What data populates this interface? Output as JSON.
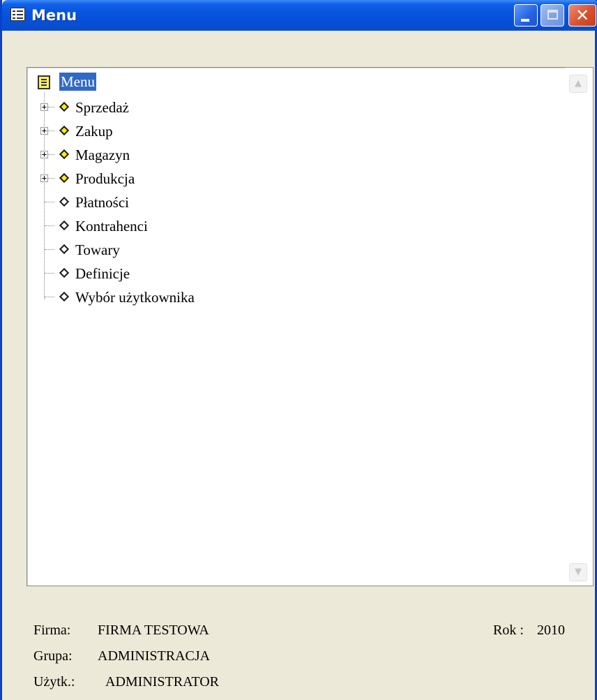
{
  "window": {
    "title": "Menu",
    "title_icon": "form-icon",
    "buttons": {
      "minimize": "minimize-icon",
      "maximize": "maximize-icon",
      "close": "close-icon",
      "close_glyph": "✕"
    }
  },
  "tree": {
    "root": "Menu",
    "items": [
      {
        "label": "Sprzedaż",
        "expandable": true,
        "bullet": "yellow"
      },
      {
        "label": "Zakup",
        "expandable": true,
        "bullet": "yellow"
      },
      {
        "label": "Magazyn",
        "expandable": true,
        "bullet": "yellow"
      },
      {
        "label": "Produkcja",
        "expandable": true,
        "bullet": "yellow"
      },
      {
        "label": "Płatności",
        "expandable": false,
        "bullet": "white"
      },
      {
        "label": "Kontrahenci",
        "expandable": false,
        "bullet": "white"
      },
      {
        "label": "Towary",
        "expandable": false,
        "bullet": "white"
      },
      {
        "label": "Definicje",
        "expandable": false,
        "bullet": "white"
      },
      {
        "label": "Wybór użytkownika",
        "expandable": false,
        "bullet": "white"
      }
    ]
  },
  "status": {
    "firma_label": "Firma:",
    "firma_value": "FIRMA TESTOWA",
    "rok_label": "Rok :",
    "rok_value": "2010",
    "grupa_label": "Grupa:",
    "grupa_value": "ADMINISTRACJA",
    "uzytk_label": "Użytk.:",
    "uzytk_value": "ADMINISTRATOR"
  },
  "colors": {
    "titlebar": "#0A55DD",
    "selection": "#3169C6",
    "close_button": "#D9512F",
    "window_bg": "#ECE9D8"
  }
}
